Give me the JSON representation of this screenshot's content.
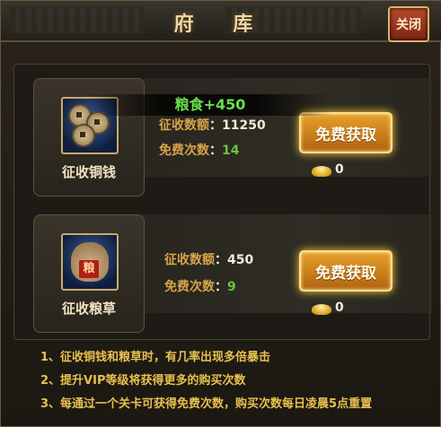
{
  "window": {
    "title": "府 库",
    "close_label": "关闭"
  },
  "items": [
    {
      "label": "征收铜钱",
      "icon": "coins-icon",
      "amount_key": "征收数额",
      "amount_value": "11250",
      "free_key": "免费次数",
      "free_value": "14",
      "button_label": "免费获取",
      "cost": "0"
    },
    {
      "label": "征收粮草",
      "icon": "grain-sack-icon",
      "amount_key": "征收数额",
      "amount_value": "450",
      "free_key": "免费次数",
      "free_value": "9",
      "button_label": "免费获取",
      "cost": "0"
    }
  ],
  "toast": "粮食+450",
  "sack_tag": "粮",
  "notes": [
    "1、征收铜钱和粮草时，有几率出现多倍暴击",
    "2、提升VIP等级将获得更多的购买次数",
    "3、每通过一个关卡可获得免费次数，购买次数每日凌晨5点重置"
  ],
  "colors": {
    "accent_gold": "#d8a34a",
    "free_green": "#67c53c",
    "button_orange": "#e7a02b"
  }
}
